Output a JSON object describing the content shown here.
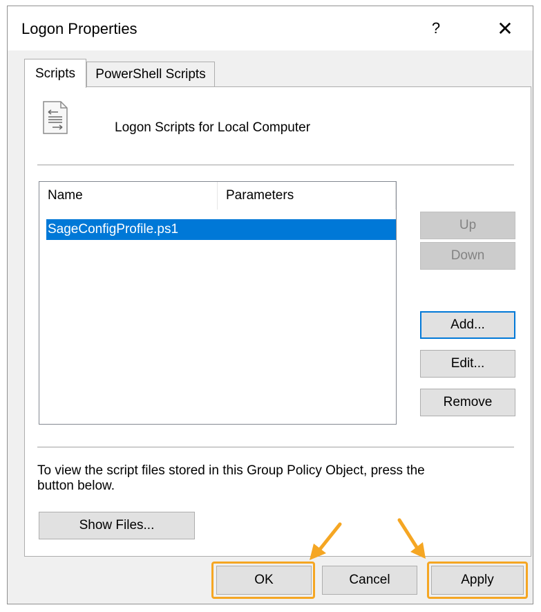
{
  "window": {
    "title": "Logon Properties",
    "help_label": "?",
    "close_label": "✕"
  },
  "tabs": [
    {
      "label": "Scripts",
      "active": true
    },
    {
      "label": "PowerShell Scripts",
      "active": false
    }
  ],
  "header": {
    "icon": "script-document-icon",
    "label": "Logon Scripts for Local Computer"
  },
  "list": {
    "columns": [
      "Name",
      "Parameters"
    ],
    "rows": [
      {
        "name": "SageConfigProfile.ps1",
        "parameters": "",
        "selected": true
      }
    ]
  },
  "side_buttons": {
    "up": "Up",
    "down": "Down",
    "add": "Add...",
    "edit": "Edit...",
    "remove": "Remove"
  },
  "info_text": "To view the script files stored in this Group Policy Object, press the button below.",
  "show_files_label": "Show Files...",
  "footer": {
    "ok": "OK",
    "cancel": "Cancel",
    "apply": "Apply"
  },
  "colors": {
    "selection": "#0078d7",
    "annotation": "#f5a623"
  }
}
